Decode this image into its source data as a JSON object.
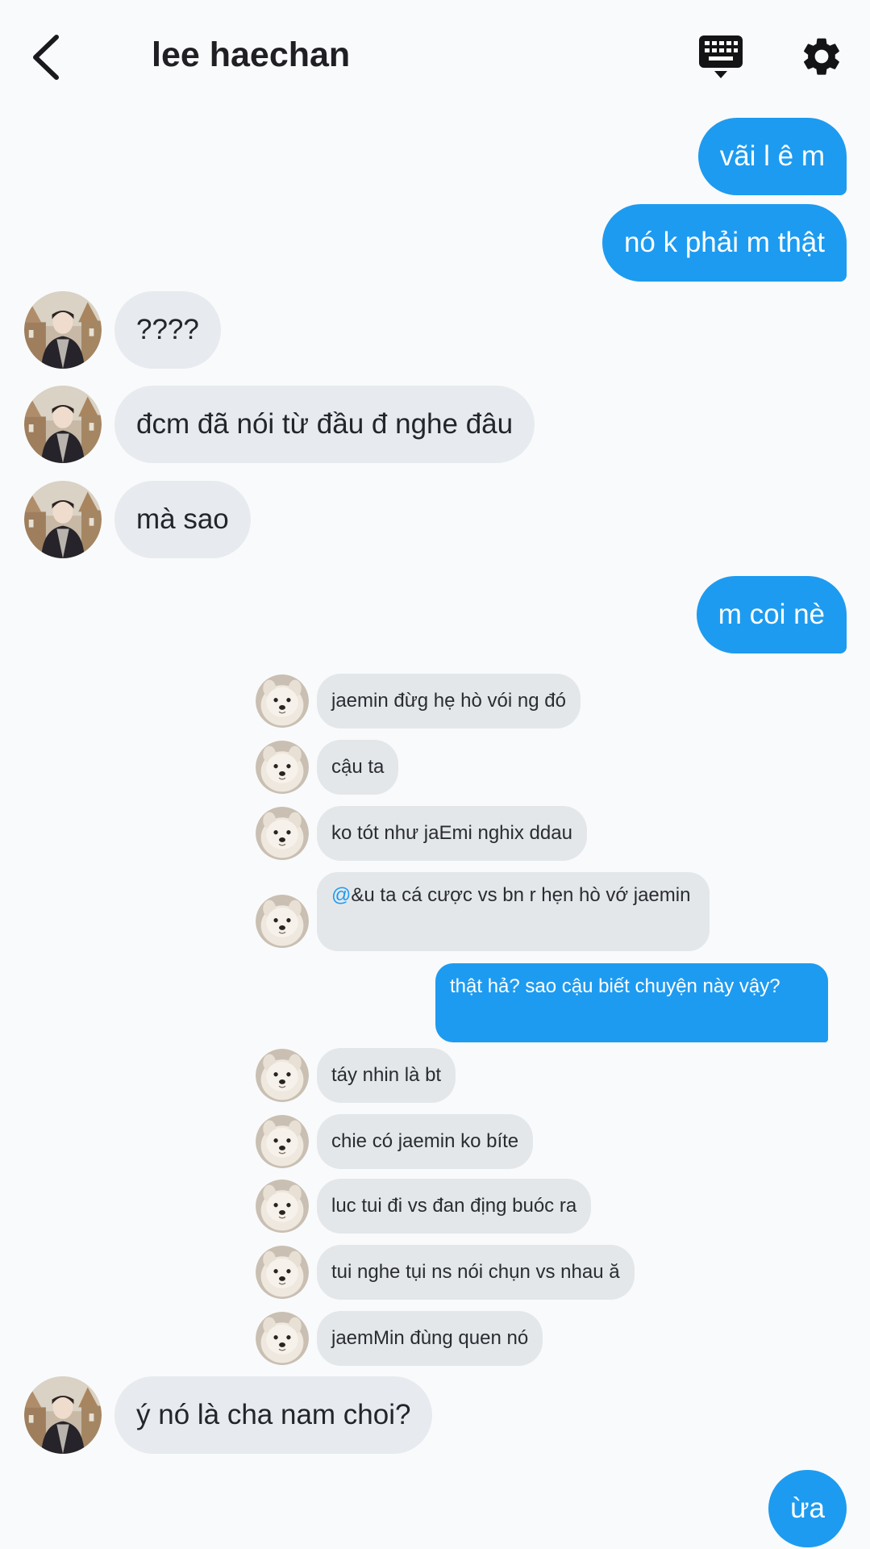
{
  "header": {
    "back_icon": "chevron-left-icon",
    "contact_name": "lee haechan",
    "keyboard_icon": "keyboard-icon",
    "settings_icon": "gear-icon"
  },
  "colors": {
    "sent_bubble": "#1d9bf0",
    "received_bubble": "#e7eaee",
    "background": "#f9fafb"
  },
  "messages": [
    {
      "from": "me",
      "text": "vãi l ê m"
    },
    {
      "from": "me",
      "text": "nó k phải m thật"
    },
    {
      "from": "them",
      "text": "????"
    },
    {
      "from": "them",
      "text": "đcm đã nói từ đầu đ nghe đâu"
    },
    {
      "from": "them",
      "text": "mà sao"
    },
    {
      "from": "me",
      "text": "m coi nè"
    },
    {
      "from": "them",
      "text": "ý nó là cha nam choi?"
    },
    {
      "from": "me",
      "text": "ừa"
    }
  ],
  "shared_screenshot": {
    "messages": [
      {
        "from": "them",
        "text": "jaemin đừg hẹ hò vói ng đó"
      },
      {
        "from": "them",
        "text": "cậu ta"
      },
      {
        "from": "them",
        "text": "ko tót như jaEmi nghix ddau"
      },
      {
        "from": "them",
        "mention": "@",
        "text": "&u ta cá cược vs bn r hẹn hò vớ jaemin"
      },
      {
        "from": "me",
        "text": "thật hả? sao cậu biết chuyện này vậy?"
      },
      {
        "from": "them",
        "text": "táy nhin là bt"
      },
      {
        "from": "them",
        "text": "chie có jaemin ko bíte"
      },
      {
        "from": "them",
        "text": "luc tui đi vs đan địng buóc ra"
      },
      {
        "from": "them",
        "text": "tui nghe tụi ns nói chụn vs nhau ă"
      },
      {
        "from": "them",
        "text": "jaemMin đùng quen nó"
      }
    ]
  }
}
